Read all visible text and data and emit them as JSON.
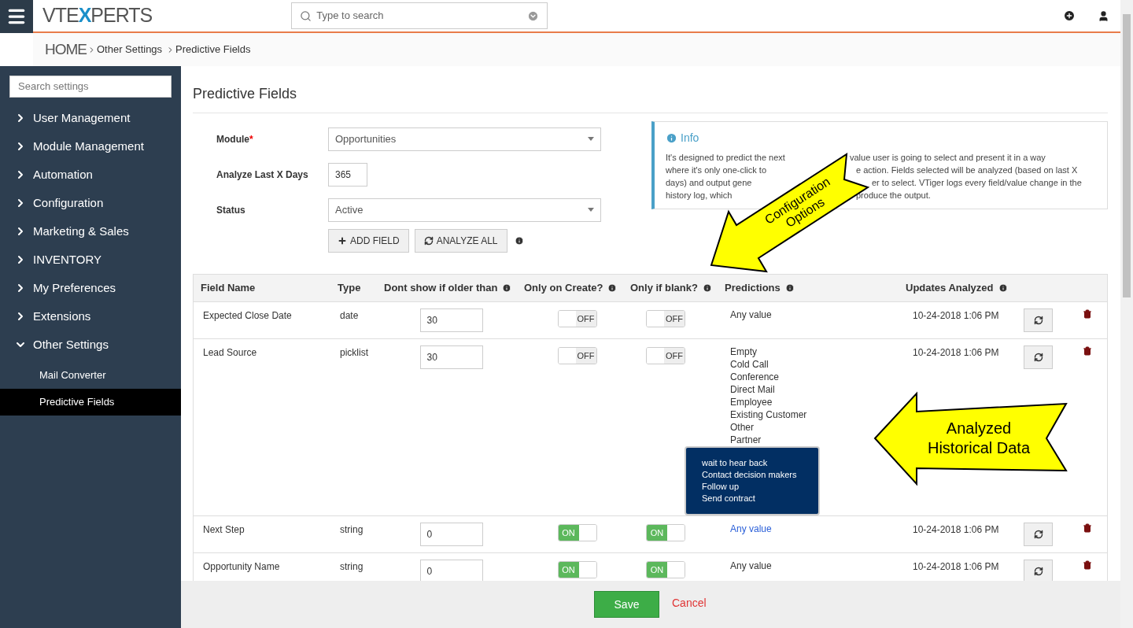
{
  "header": {
    "logo": {
      "left": "VTE",
      "mark": "X",
      "right": "PERTS"
    },
    "search": {
      "placeholder": "Type to search"
    }
  },
  "breadcrumb": {
    "home": "HOME",
    "items": [
      "Other Settings",
      "Predictive Fields"
    ]
  },
  "sidebar": {
    "search": {
      "placeholder": "Search settings"
    },
    "items": [
      {
        "label": "User Management",
        "expanded": false
      },
      {
        "label": "Module Management",
        "expanded": false
      },
      {
        "label": "Automation",
        "expanded": false
      },
      {
        "label": "Configuration",
        "expanded": false
      },
      {
        "label": "Marketing & Sales",
        "expanded": false
      },
      {
        "label": "INVENTORY",
        "expanded": false
      },
      {
        "label": "My Preferences",
        "expanded": false
      },
      {
        "label": "Extensions",
        "expanded": false
      },
      {
        "label": "Other Settings",
        "expanded": true,
        "children": [
          {
            "label": "Mail Converter",
            "selected": false
          },
          {
            "label": "Predictive Fields",
            "selected": true
          }
        ]
      }
    ]
  },
  "page": {
    "title": "Predictive Fields",
    "form": [
      {
        "label": "Module",
        "required_mark": "*",
        "kind": "select",
        "value": "Opportunities"
      },
      {
        "label": "Analyze Last X Days",
        "kind": "input",
        "value": "365"
      },
      {
        "label": "Status",
        "kind": "select",
        "value": "Active"
      }
    ],
    "buttons": [
      "ADD FIELD",
      "ANALYZE ALL"
    ],
    "info": {
      "title": "Info",
      "lines": [
        [
          "It's designed to predict the next",
          "value user is going to select and present it in a way"
        ],
        [
          "where it's only one-click to",
          "e action. Fields selected will be analyzed (based on last X"
        ],
        [
          "days) and output gene",
          "er to select. VTiger logs every field/value change in the"
        ],
        [
          "history log, which",
          "produce the output."
        ]
      ]
    },
    "table": {
      "columns": [
        "Field Name",
        "Type",
        "Dont show if older than",
        "Only on Create?",
        "Only if blank?",
        "Predictions",
        "Updates Analyzed"
      ],
      "rows": [
        {
          "name": "Expected Close Date",
          "type": "date",
          "days": "30",
          "only_on_create": {
            "on": false,
            "label": "OFF"
          },
          "only_if_blank": {
            "on": false,
            "label": "OFF"
          },
          "predictions": [
            "Any value"
          ],
          "highlighted": false,
          "updated": "10-24-2018 1:06 PM"
        },
        {
          "name": "Lead Source",
          "type": "picklist",
          "days": "30",
          "only_on_create": {
            "on": false,
            "label": "OFF"
          },
          "only_if_blank": {
            "on": false,
            "label": "OFF"
          },
          "predictions": [
            "Empty",
            "Cold Call",
            "Conference",
            "Direct Mail",
            "Employee",
            "Existing Customer",
            "Other",
            "Partner"
          ],
          "highlighted": false,
          "updated": "10-24-2018 1:06 PM"
        },
        {
          "name": "Next Step",
          "type": "string",
          "days": "0",
          "only_on_create": {
            "on": true,
            "label": "ON"
          },
          "only_if_blank": {
            "on": true,
            "label": "ON"
          },
          "predictions": [
            "Any value"
          ],
          "highlighted": true,
          "updated": "10-24-2018 1:06 PM"
        },
        {
          "name": "Opportunity Name",
          "type": "string",
          "days": "0",
          "only_on_create": {
            "on": true,
            "label": "ON"
          },
          "only_if_blank": {
            "on": true,
            "label": "ON"
          },
          "predictions": [
            "Any value"
          ],
          "highlighted": false,
          "updated": "10-24-2018 1:06 PM"
        }
      ]
    },
    "tooltip": [
      "wait to hear back",
      "Contact decision makers",
      "Follow up",
      "Send contract"
    ]
  },
  "footer": {
    "save": "Save",
    "cancel": "Cancel"
  },
  "annotations": [
    {
      "lines": [
        "Configuration",
        "Options"
      ]
    },
    {
      "lines": [
        "Analyzed",
        "Historical Data"
      ]
    }
  ]
}
